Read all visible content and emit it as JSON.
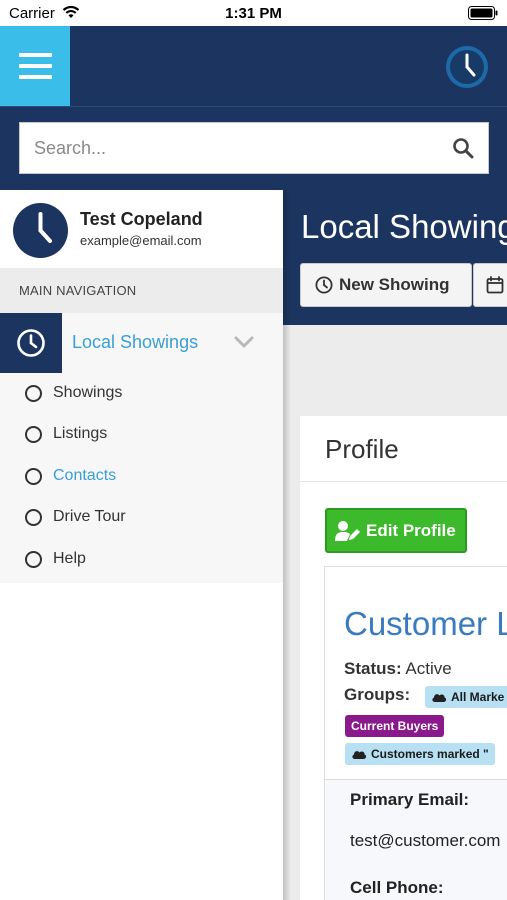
{
  "status_bar": {
    "carrier": "Carrier",
    "time": "1:31 PM"
  },
  "search": {
    "placeholder": "Search..."
  },
  "user": {
    "name": "Test Copeland",
    "email": "example@email.com"
  },
  "sidebar": {
    "header": "MAIN NAVIGATION",
    "group_label": "Local Showings",
    "items": [
      {
        "label": "Showings",
        "active": false
      },
      {
        "label": "Listings",
        "active": false
      },
      {
        "label": "Contacts",
        "active": true
      },
      {
        "label": "Drive Tour",
        "active": false
      },
      {
        "label": "Help",
        "active": false
      }
    ]
  },
  "main": {
    "title": "Local Showings",
    "new_showing_label": "New Showing",
    "profile_title": "Profile",
    "edit_profile_label": "Edit Profile",
    "customer_name": "Customer L",
    "status_label": "Status:",
    "status_value": "Active",
    "groups_label": "Groups:",
    "tags": [
      "All Marke",
      "Current Buyers",
      "Customers marked \""
    ],
    "primary_email_label": "Primary Email:",
    "primary_email_value": "test@customer.com",
    "cell_phone_label": "Cell Phone:"
  },
  "colors": {
    "navy": "#1c3560",
    "accent_blue": "#3bbdea",
    "link_blue": "#3a9fd1",
    "green": "#3cba2b",
    "purple_tag": "#8a1a8c",
    "light_blue_tag": "#b7e0f3"
  },
  "icons": [
    "hamburger-icon",
    "clock-logo-icon",
    "search-icon",
    "clock-icon",
    "chevron-down-icon",
    "calendar-icon",
    "user-edit-icon",
    "cloud-icon"
  ]
}
